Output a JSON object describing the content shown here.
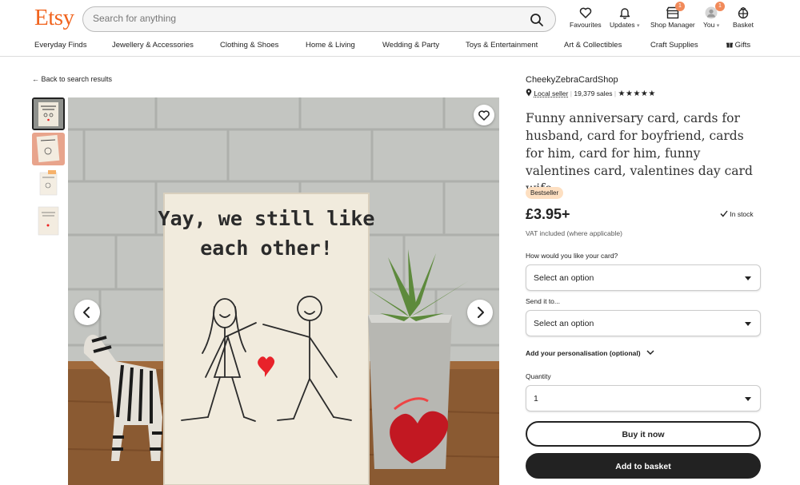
{
  "header": {
    "logo": "Etsy",
    "search_placeholder": "Search for anything",
    "nav": {
      "favourites": "Favourites",
      "updates": "Updates",
      "shop_manager": "Shop Manager",
      "shop_manager_badge": "1",
      "you": "You",
      "you_badge": "1",
      "basket": "Basket"
    },
    "categories": [
      "Everyday Finds",
      "Jewellery & Accessories",
      "Clothing & Shoes",
      "Home & Living",
      "Wedding & Party",
      "Toys & Entertainment",
      "Art & Collectibles",
      "Craft Supplies",
      "Gifts"
    ]
  },
  "listing": {
    "back_link": "Back to search results",
    "card_text_line1": "Yay, we still like",
    "card_text_line2": "each other!",
    "shop_name": "CheekyZebraCardShop",
    "local_seller": "Local seller",
    "sales": "19,379 sales",
    "stars": "★★★★★",
    "title": "Funny anniversary card, cards for husband, card for boyfriend, cards for him, card for him, funny valentines card, valentines day card wife",
    "bestseller": "Bestseller",
    "price": "£3.95+",
    "stock": "In stock",
    "vat": "VAT included (where applicable)",
    "option1_label": "How would you like your card?",
    "option1_value": "Select an option",
    "option2_label": "Send it to...",
    "option2_value": "Select an option",
    "personalisation": "Add your personalisation (optional)",
    "quantity_label": "Quantity",
    "quantity_value": "1",
    "buy_now": "Buy it now",
    "add_to_basket": "Add to basket"
  },
  "colors": {
    "brand": "#f1641e",
    "badge": "#f18a5a",
    "bestseller_bg": "#fddfc1",
    "primary_button": "#222222"
  }
}
